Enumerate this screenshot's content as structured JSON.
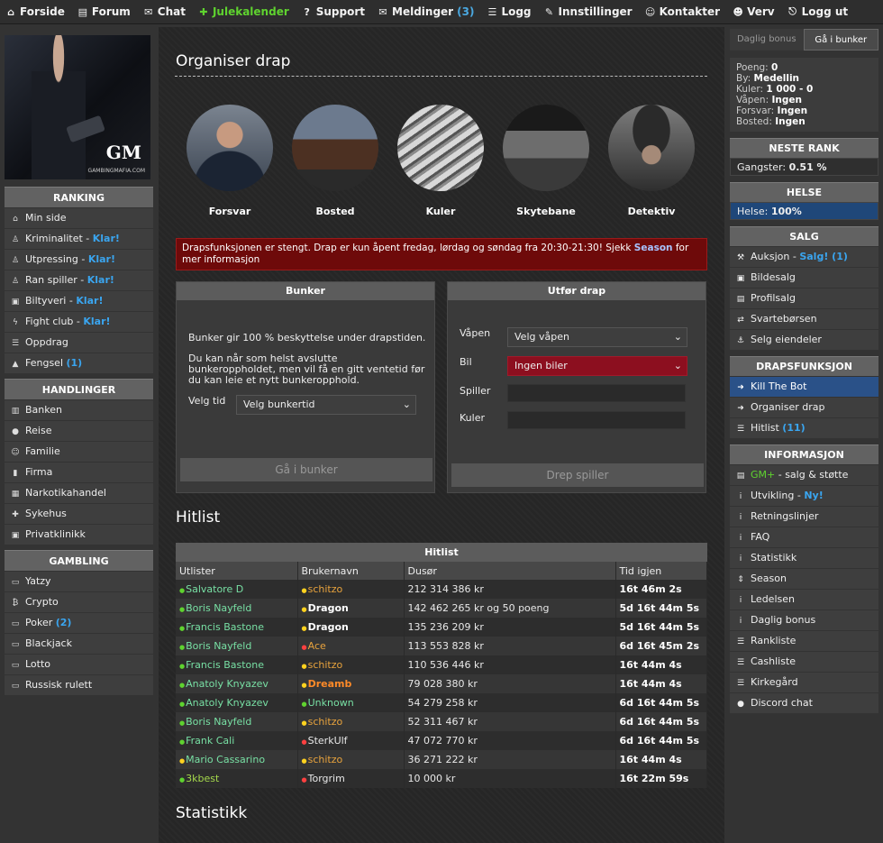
{
  "topnav": [
    {
      "label": "Forside",
      "icon": "home-icon",
      "glyph": "⌂"
    },
    {
      "label": "Forum",
      "icon": "forum-icon",
      "glyph": "▤"
    },
    {
      "label": "Chat",
      "icon": "chat-icon",
      "glyph": "✉"
    },
    {
      "label": "Julekalender",
      "icon": "gift-icon",
      "glyph": "✚",
      "accent": "#5fd32f"
    },
    {
      "label": "Support",
      "icon": "question-icon",
      "glyph": "?"
    },
    {
      "label": "Meldinger",
      "icon": "envelope-icon",
      "glyph": "✉",
      "badge": "(3)"
    },
    {
      "label": "Logg",
      "icon": "list-icon",
      "glyph": "☰"
    },
    {
      "label": "Innstillinger",
      "icon": "wrench-icon",
      "glyph": "✎"
    },
    {
      "label": "Kontakter",
      "icon": "users-icon",
      "glyph": "☺"
    },
    {
      "label": "Verv",
      "icon": "user-plus-icon",
      "glyph": "☻"
    },
    {
      "label": "Logg ut",
      "icon": "logout-icon",
      "glyph": "⎋"
    }
  ],
  "logo": {
    "gm": "GM",
    "site": "GAMBINGMAFIA.COM"
  },
  "left": {
    "ranking": {
      "title": "RANKING",
      "items": [
        {
          "label": "Min side",
          "icon": "home-icon",
          "glyph": "⌂"
        },
        {
          "label": "Kriminalitet - ",
          "hl": "Klar!",
          "icon": "person-icon",
          "glyph": "♙"
        },
        {
          "label": "Utpressing - ",
          "hl": "Klar!",
          "icon": "person-icon",
          "glyph": "♙"
        },
        {
          "label": "Ran spiller - ",
          "hl": "Klar!",
          "icon": "person-icon",
          "glyph": "♙"
        },
        {
          "label": "Biltyveri - ",
          "hl": "Klar!",
          "icon": "car-icon",
          "glyph": "▣"
        },
        {
          "label": "Fight club - ",
          "hl": "Klar!",
          "icon": "bolt-icon",
          "glyph": "ϟ"
        },
        {
          "label": "Oppdrag",
          "icon": "list-icon",
          "glyph": "☰"
        },
        {
          "label": "Fengsel ",
          "hl": "(1)",
          "icon": "lock-icon",
          "glyph": "▲"
        }
      ]
    },
    "handlinger": {
      "title": "HANDLINGER",
      "items": [
        {
          "label": "Banken",
          "icon": "bank-icon",
          "glyph": "▥"
        },
        {
          "label": "Reise",
          "icon": "globe-icon",
          "glyph": "●"
        },
        {
          "label": "Familie",
          "icon": "family-icon",
          "glyph": "☺"
        },
        {
          "label": "Firma",
          "icon": "building-icon",
          "glyph": "▮"
        },
        {
          "label": "Narkotikahandel",
          "icon": "drugs-icon",
          "glyph": "▦"
        },
        {
          "label": "Sykehus",
          "icon": "hospital-icon",
          "glyph": "✚"
        },
        {
          "label": "Privatklinikk",
          "icon": "clinic-icon",
          "glyph": "▣"
        }
      ]
    },
    "gambling": {
      "title": "GAMBLING",
      "items": [
        {
          "label": "Yatzy",
          "icon": "money-icon",
          "glyph": "▭"
        },
        {
          "label": "Crypto",
          "icon": "bitcoin-icon",
          "glyph": "₿"
        },
        {
          "label": "Poker ",
          "hl": "(2)",
          "icon": "money-icon",
          "glyph": "▭"
        },
        {
          "label": "Blackjack",
          "icon": "money-icon",
          "glyph": "▭"
        },
        {
          "label": "Lotto",
          "icon": "money-icon",
          "glyph": "▭"
        },
        {
          "label": "Russisk rulett",
          "icon": "money-icon",
          "glyph": "▭"
        }
      ]
    }
  },
  "main": {
    "title": "Organiser drap",
    "circles": [
      {
        "label": "Forsvar",
        "img": "forsvar-image"
      },
      {
        "label": "Bosted",
        "img": "bosted-image"
      },
      {
        "label": "Kuler",
        "img": "kuler-image"
      },
      {
        "label": "Skytebane",
        "img": "skytebane-image"
      },
      {
        "label": "Detektiv",
        "img": "detektiv-image"
      }
    ],
    "alert": {
      "text": "Drapsfunksjonen er stengt. Drap er kun åpent fredag, lørdag og søndag fra 20:30-21:30! Sjekk ",
      "link": "Season",
      "after": " for mer informasjon"
    },
    "bunker": {
      "title": "Bunker",
      "p1": "Bunker gir 100 % beskyttelse under drapstiden.",
      "p2": "Du kan når som helst avslutte bunkeroppholdet, men vil få en gitt ventetid før du kan leie et nytt bunkeropphold.",
      "label": "Velg tid",
      "select": "Velg bunkertid",
      "button": "Gå i bunker"
    },
    "drap": {
      "title": "Utfør drap",
      "weapon_label": "Våpen",
      "weapon_value": "Velg våpen",
      "car_label": "Bil",
      "car_value": "Ingen biler",
      "player_label": "Spiller",
      "bullets_label": "Kuler",
      "button": "Drep spiller"
    },
    "hitlist_title": "Hitlist",
    "hitlist": {
      "title": "Hitlist",
      "headers": [
        "Utlister",
        "Brukernavn",
        "Dusør",
        "Tid igjen"
      ],
      "rows": [
        {
          "a": "Salvatore D",
          "ac": "u-green",
          "ad": "#5fd32f",
          "b": "schitzo",
          "bc": "u-orange",
          "bd": "#ffd21f",
          "c": "212 314 386 kr",
          "t": "16t 46m 2s"
        },
        {
          "a": "Boris Nayfeld",
          "ac": "u-green",
          "ad": "#5fd32f",
          "b": "Dragon",
          "bc": "u-white",
          "bd": "#ffd21f",
          "c": "142 462 265 kr og 50 poeng",
          "t": "5d 16t 44m 5s"
        },
        {
          "a": "Francis Bastone",
          "ac": "u-green",
          "ad": "#5fd32f",
          "b": "Dragon",
          "bc": "u-white",
          "bd": "#ffd21f",
          "c": "135 236 209 kr",
          "t": "5d 16t 44m 5s"
        },
        {
          "a": "Boris Nayfeld",
          "ac": "u-green",
          "ad": "#5fd32f",
          "b": "Ace",
          "bc": "u-orange",
          "bd": "#ff4040",
          "c": "113 553 828 kr",
          "t": "6d 16t 45m 2s"
        },
        {
          "a": "Francis Bastone",
          "ac": "u-green",
          "ad": "#5fd32f",
          "b": "schitzo",
          "bc": "u-orange",
          "bd": "#ffd21f",
          "c": "110 536 446 kr",
          "t": "16t 44m 4s"
        },
        {
          "a": "Anatoly Knyazev",
          "ac": "u-green",
          "ad": "#5fd32f",
          "b": "Dreamb",
          "bc": "u-bold-orange",
          "bd": "#ffd21f",
          "c": "79 028 380 kr",
          "t": "16t 44m 4s"
        },
        {
          "a": "Anatoly Knyazev",
          "ac": "u-green",
          "ad": "#5fd32f",
          "b": "Unknown",
          "bc": "u-green",
          "bd": "#5fd32f",
          "c": "54 279 258 kr",
          "t": "6d 16t 44m 5s"
        },
        {
          "a": "Boris Nayfeld",
          "ac": "u-green",
          "ad": "#5fd32f",
          "b": "schitzo",
          "bc": "u-orange",
          "bd": "#ffd21f",
          "c": "52 311 467 kr",
          "t": "6d 16t 44m 5s"
        },
        {
          "a": "Frank Cali",
          "ac": "u-green",
          "ad": "#5fd32f",
          "b": "SterkUlf",
          "bc": "u-red",
          "bd": "#ff4040",
          "c": "47 072 770 kr",
          "t": "6d 16t 44m 5s"
        },
        {
          "a": "Mario Cassarino",
          "ac": "u-green",
          "ad": "#ffd21f",
          "b": "schitzo",
          "bc": "u-orange",
          "bd": "#ffd21f",
          "c": "36 271 222 kr",
          "t": "16t 44m 4s"
        },
        {
          "a": "3kbest",
          "ac": "u-lime",
          "ad": "#5fd32f",
          "b": "Torgrim",
          "bc": "u-red",
          "bd": "#ff4040",
          "c": "10 000 kr",
          "t": "16t 22m 59s"
        }
      ]
    },
    "stats_title": "Statistikk"
  },
  "right": {
    "tabs": [
      "Daglig bonus",
      "Gå i bunker"
    ],
    "stats": [
      {
        "k": "Poeng:",
        "v": "0"
      },
      {
        "k": "By:",
        "v": "Medellin"
      },
      {
        "k": "Kuler:",
        "v": "1 000 - 0"
      },
      {
        "k": "Våpen:",
        "v": "Ingen"
      },
      {
        "k": "Forsvar:",
        "v": "Ingen"
      },
      {
        "k": "Bosted:",
        "v": "Ingen"
      }
    ],
    "neste": {
      "title": "NESTE RANK",
      "k": "Gangster:",
      "v": "0.51 %"
    },
    "helse": {
      "title": "HELSE",
      "k": "Helse:",
      "v": "100%"
    },
    "salg": {
      "title": "SALG",
      "items": [
        {
          "label": "Auksjon - ",
          "hl": "Salg! (1)",
          "icon": "gavel-icon",
          "glyph": "⚒"
        },
        {
          "label": "Bildesalg",
          "icon": "camera-icon",
          "glyph": "▣"
        },
        {
          "label": "Profilsalg",
          "icon": "cart-icon",
          "glyph": "▤"
        },
        {
          "label": "Svartebørsen",
          "icon": "exchange-icon",
          "glyph": "⇄"
        },
        {
          "label": "Selg eiendeler",
          "icon": "anchor-icon",
          "glyph": "⚓"
        }
      ]
    },
    "drapsfunksjon": {
      "title": "DRAPSFUNKSJON",
      "items": [
        {
          "label": "Kill The Bot",
          "icon": "arrow-right-icon",
          "glyph": "➜",
          "active": true
        },
        {
          "label": "Organiser drap",
          "icon": "arrow-right-icon",
          "glyph": "➜"
        },
        {
          "label": "Hitlist ",
          "hl": "(11)",
          "icon": "list-icon",
          "glyph": "☰"
        }
      ]
    },
    "informasjon": {
      "title": "INFORMASJON",
      "items": [
        {
          "label": "",
          "gl": "GM+",
          "after": " - salg & støtte",
          "icon": "cart-icon",
          "glyph": "▤"
        },
        {
          "label": "Utvikling - ",
          "hl": "Ny!",
          "icon": "info-icon",
          "glyph": "i"
        },
        {
          "label": "Retningslinjer",
          "icon": "info-icon",
          "glyph": "i"
        },
        {
          "label": "FAQ",
          "icon": "info-icon",
          "glyph": "i"
        },
        {
          "label": "Statistikk",
          "icon": "info-icon",
          "glyph": "i"
        },
        {
          "label": "Season",
          "icon": "sort-icon",
          "glyph": "⇕"
        },
        {
          "label": "Ledelsen",
          "icon": "info-icon",
          "glyph": "i"
        },
        {
          "label": "Daglig bonus",
          "icon": "info-icon",
          "glyph": "i"
        },
        {
          "label": "Rankliste",
          "icon": "list-icon",
          "glyph": "☰"
        },
        {
          "label": "Cashliste",
          "icon": "list-icon",
          "glyph": "☰"
        },
        {
          "label": "Kirkegård",
          "icon": "list-icon",
          "glyph": "☰"
        },
        {
          "label": "Discord chat",
          "icon": "discord-icon",
          "glyph": "●"
        }
      ]
    }
  }
}
